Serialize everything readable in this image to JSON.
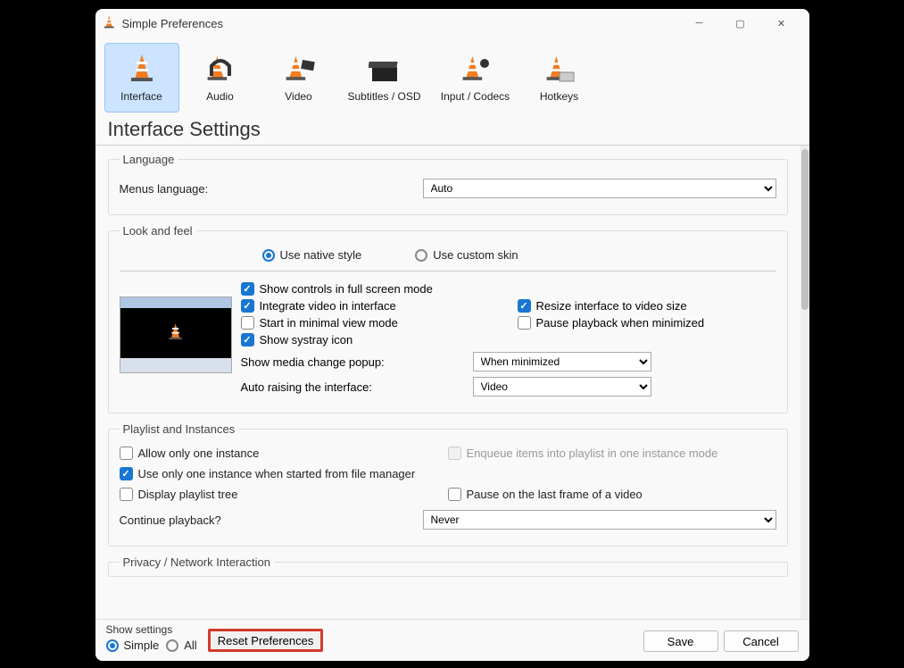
{
  "window": {
    "title": "Simple Preferences"
  },
  "tabs": [
    {
      "label": "Interface"
    },
    {
      "label": "Audio"
    },
    {
      "label": "Video"
    },
    {
      "label": "Subtitles / OSD"
    },
    {
      "label": "Input / Codecs"
    },
    {
      "label": "Hotkeys"
    }
  ],
  "heading": "Interface Settings",
  "language": {
    "legend": "Language",
    "menus_label": "Menus language:",
    "menus_value": "Auto"
  },
  "look": {
    "legend": "Look and feel",
    "native": "Use native style",
    "custom": "Use custom skin",
    "show_controls": "Show controls in full screen mode",
    "integrate": "Integrate video in interface",
    "resize": "Resize interface to video size",
    "start_min": "Start in minimal view mode",
    "pause_min": "Pause playback when minimized",
    "systray": "Show systray icon",
    "media_change_label": "Show media change popup:",
    "media_change_value": "When minimized",
    "auto_raise_label": "Auto raising the interface:",
    "auto_raise_value": "Video"
  },
  "playlist": {
    "legend": "Playlist and Instances",
    "one_instance": "Allow only one instance",
    "enqueue": "Enqueue items into playlist in one instance mode",
    "file_manager": "Use only one instance when started from file manager",
    "display_tree": "Display playlist tree",
    "pause_last": "Pause on the last frame of a video",
    "continue_label": "Continue playback?",
    "continue_value": "Never"
  },
  "privacy": {
    "legend": "Privacy / Network Interaction"
  },
  "footer": {
    "show_settings": "Show settings",
    "simple": "Simple",
    "all": "All",
    "reset": "Reset Preferences",
    "save": "Save",
    "cancel": "Cancel"
  }
}
